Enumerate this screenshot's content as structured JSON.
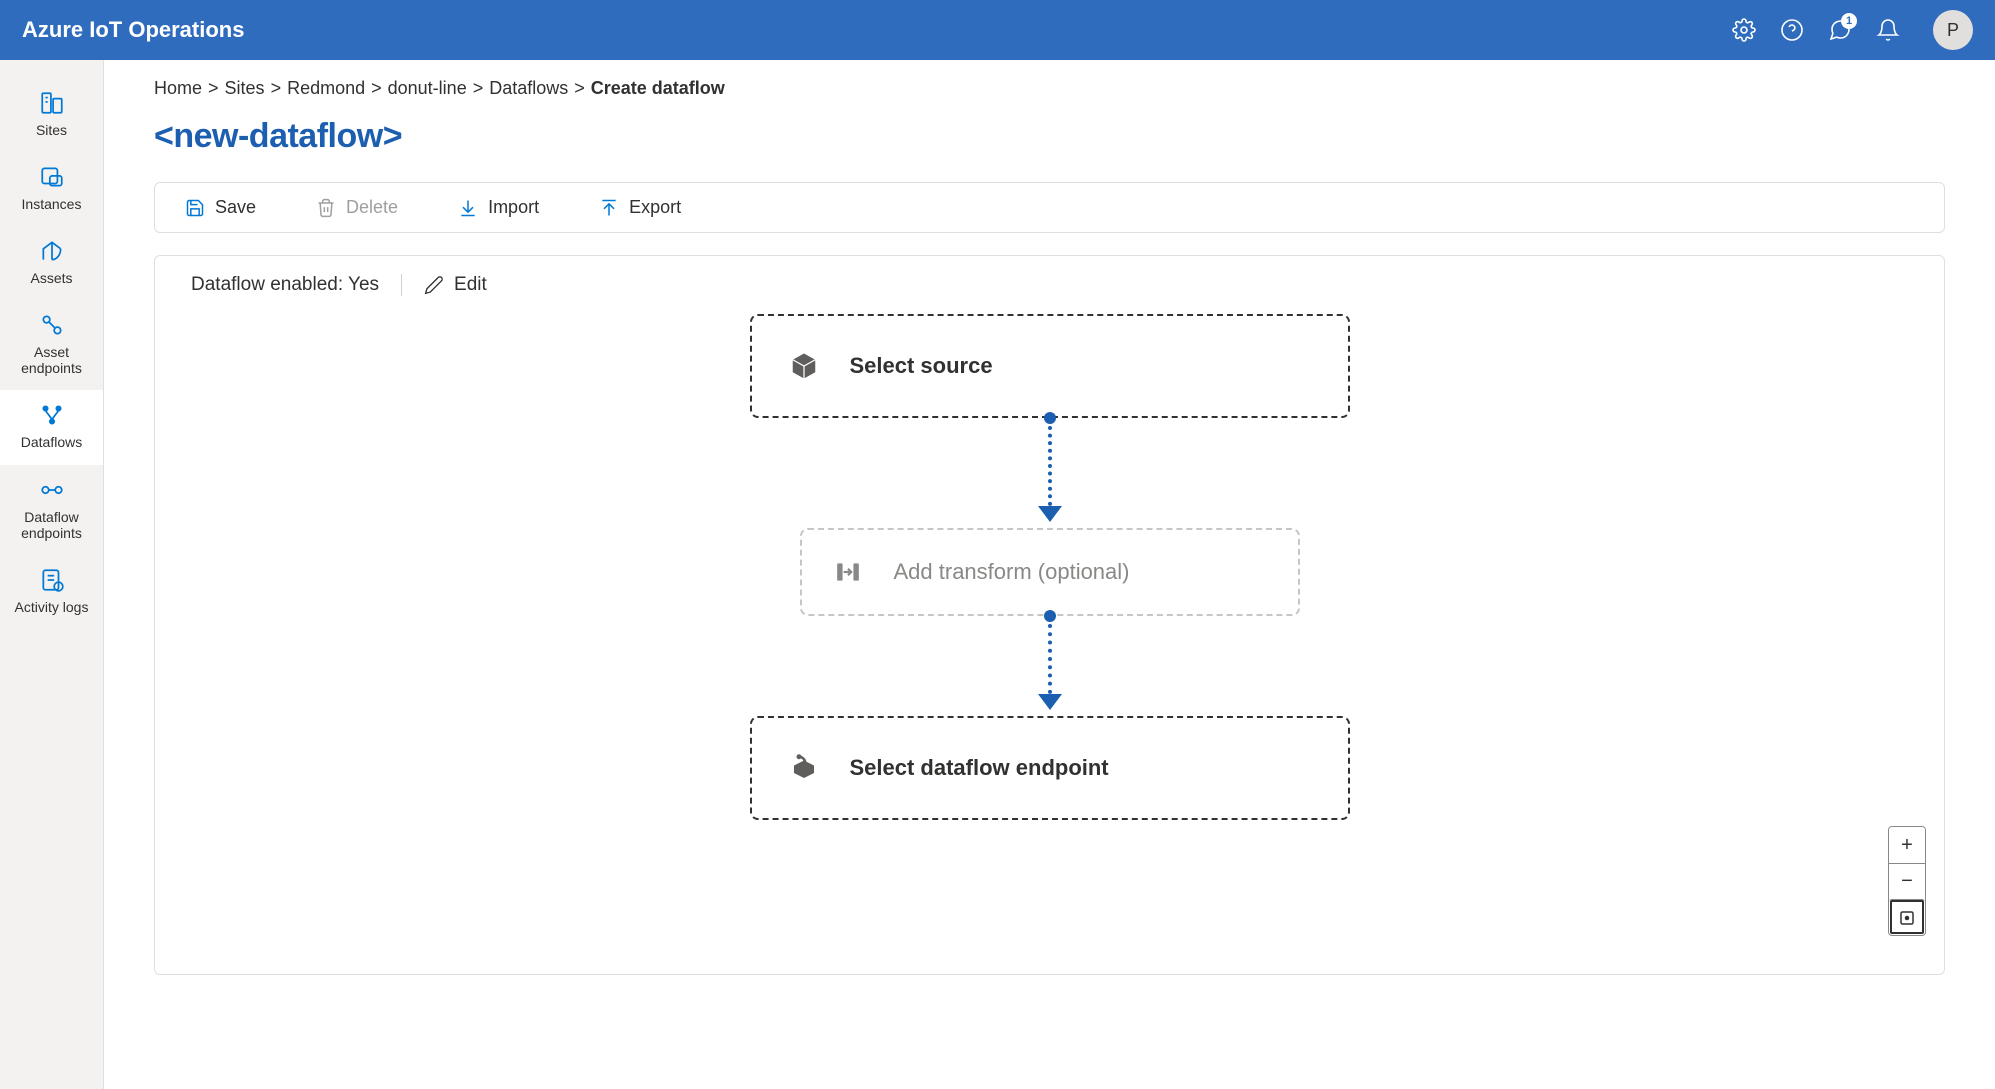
{
  "header": {
    "product": "Azure IoT Operations",
    "notification_count": "1",
    "avatar_initial": "P"
  },
  "sidenav": {
    "items": [
      {
        "label": "Sites"
      },
      {
        "label": "Instances"
      },
      {
        "label": "Assets"
      },
      {
        "label": "Asset endpoints"
      },
      {
        "label": "Dataflows"
      },
      {
        "label": "Dataflow endpoints"
      },
      {
        "label": "Activity logs"
      }
    ]
  },
  "breadcrumb": {
    "items": [
      "Home",
      "Sites",
      "Redmond",
      "donut-line",
      "Dataflows"
    ],
    "current": "Create dataflow"
  },
  "page": {
    "title": "<new-dataflow>"
  },
  "toolbar": {
    "save": "Save",
    "delete": "Delete",
    "import": "Import",
    "export": "Export"
  },
  "canvas": {
    "enabled_label": "Dataflow enabled:",
    "enabled_value": "Yes",
    "edit": "Edit",
    "nodes": {
      "source": "Select source",
      "transform": "Add transform (optional)",
      "endpoint": "Select dataflow endpoint"
    },
    "zoom": {
      "in": "+",
      "out": "−"
    }
  }
}
